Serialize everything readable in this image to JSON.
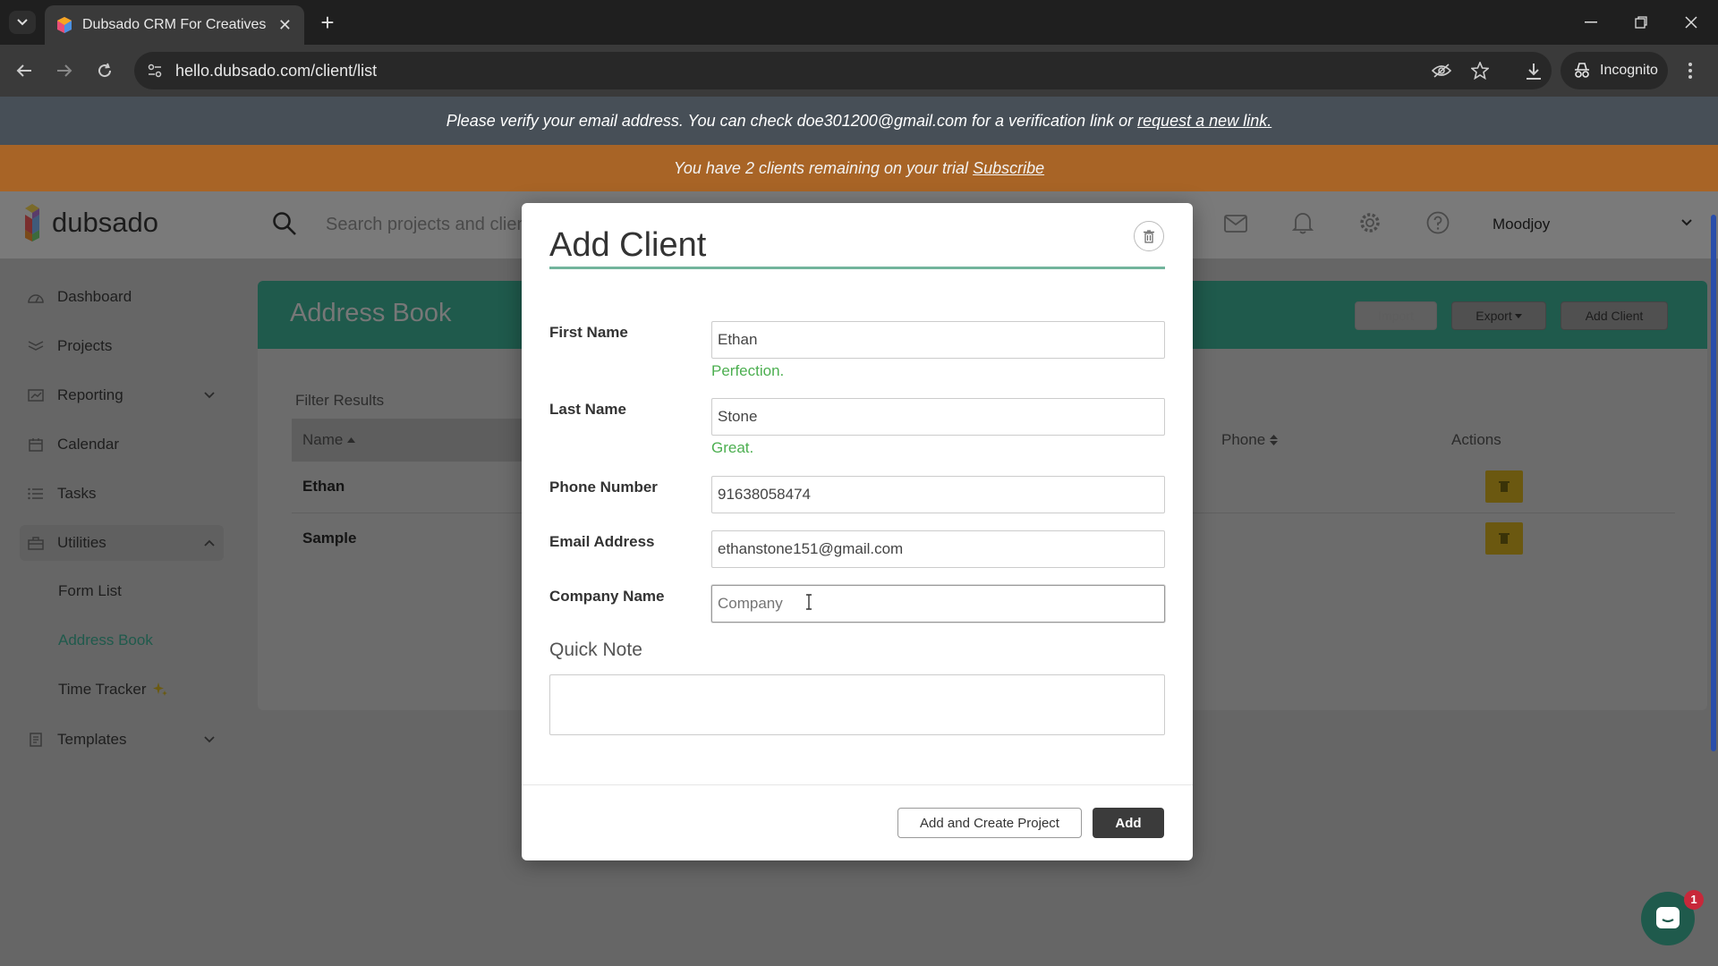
{
  "browser": {
    "tab_title": "Dubsado CRM For Creatives",
    "url": "hello.dubsado.com/client/list",
    "profile_label": "Incognito"
  },
  "banners": {
    "verify_text": "Please verify your email address. You can check doe301200@gmail.com for a verification link or",
    "verify_link": "request a new link.",
    "trial_text": "You have 2 clients remaining on your trial",
    "trial_link": "Subscribe"
  },
  "header": {
    "logo_text": "dubsado",
    "search_placeholder": "Search projects and clients",
    "user_name": "Moodjoy"
  },
  "sidebar": {
    "items": [
      {
        "label": "Dashboard",
        "icon": "dashboard-icon"
      },
      {
        "label": "Projects",
        "icon": "projects-icon"
      },
      {
        "label": "Reporting",
        "icon": "reporting-icon"
      },
      {
        "label": "Calendar",
        "icon": "calendar-icon"
      },
      {
        "label": "Tasks",
        "icon": "tasks-icon"
      },
      {
        "label": "Utilities",
        "icon": "utilities-icon"
      },
      {
        "label": "Templates",
        "icon": "templates-icon"
      }
    ],
    "sub_items": [
      "Form List",
      "Address Book",
      "Time Tracker"
    ]
  },
  "address_book": {
    "title": "Address Book",
    "buttons": {
      "import": "Import",
      "export": "Export",
      "add_client": "Add Client"
    },
    "filter_label": "Filter Results",
    "columns": {
      "name": "Name",
      "phone": "Phone",
      "actions": "Actions"
    },
    "rows": [
      {
        "name": "Ethan"
      },
      {
        "name": "Sample"
      }
    ]
  },
  "modal": {
    "title": "Add Client",
    "fields": {
      "first_name": {
        "label": "First Name",
        "value": "Ethan",
        "hint": "Perfection."
      },
      "last_name": {
        "label": "Last Name",
        "value": "Stone",
        "hint": "Great."
      },
      "phone": {
        "label": "Phone Number",
        "value": "91638058474"
      },
      "email": {
        "label": "Email Address",
        "value": "ethanstone151@gmail.com"
      },
      "company": {
        "label": "Company Name",
        "value": "",
        "placeholder": "Company"
      }
    },
    "quick_note_label": "Quick Note",
    "buttons": {
      "add_and_create": "Add and Create Project",
      "add": "Add"
    }
  },
  "chat": {
    "badge_count": "1"
  },
  "colors": {
    "accent": "#72b49c",
    "trial_banner": "#e0852f",
    "success": "#4caf50"
  }
}
